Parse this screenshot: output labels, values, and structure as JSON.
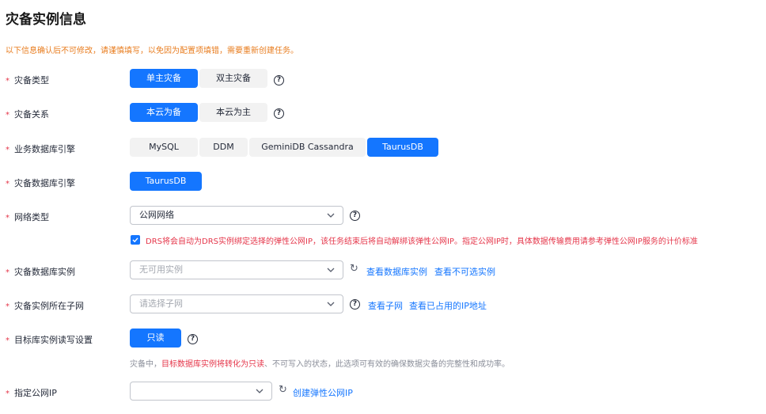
{
  "page": {
    "title": "灾备实例信息",
    "warning": "以下信息确认后不可修改，请谨慎填写，以免因为配置项填错，需要重新创建任务。"
  },
  "fields": {
    "dr_type": {
      "label": "灾备类型",
      "options": [
        "单主灾备",
        "双主灾备"
      ],
      "selected": "单主灾备"
    },
    "dr_relation": {
      "label": "灾备关系",
      "options": [
        "本云为备",
        "本云为主"
      ],
      "selected": "本云为备"
    },
    "service_engine": {
      "label": "业务数据库引擎",
      "options": [
        "MySQL",
        "DDM",
        "GeminiDB Cassandra",
        "TaurusDB"
      ],
      "selected": "TaurusDB"
    },
    "dr_engine": {
      "label": "灾备数据库引擎",
      "options": [
        "TaurusDB"
      ],
      "selected": "TaurusDB"
    },
    "network_type": {
      "label": "网络类型",
      "value": "公网网络",
      "checkbox_checked": true,
      "checkbox_text": "DRS将会自动为DRS实例绑定选择的弹性公网IP，该任务结束后将自动解绑该弹性公网IP。指定公网IP时，具体数据传输费用请参考弹性公网IP服务的计价标准"
    },
    "dr_instance": {
      "label": "灾备数据库实例",
      "placeholder": "无可用实例",
      "links": [
        "查看数据库实例",
        "查看不可选实例"
      ]
    },
    "dr_subnet": {
      "label": "灾备实例所在子网",
      "placeholder": "请选择子网",
      "links": [
        "查看子网",
        "查看已占用的IP地址"
      ]
    },
    "rw_setting": {
      "label": "目标库实例读写设置",
      "options": [
        "只读"
      ],
      "selected": "只读",
      "hint_prefix": "灾备中，",
      "hint_emphasis": "目标数据库实例将转化为只读",
      "hint_suffix": "、不可写入的状态，此选项可有效的确保数据灾备的完整性和成功率。"
    },
    "public_ip": {
      "label": "指定公网IP",
      "value": "",
      "link": "创建弹性公网IP"
    }
  },
  "colors": {
    "primary": "#1476ff",
    "required": "#e5364a",
    "warning": "#e87c1e"
  },
  "icons": [
    "help-icon",
    "chevron-down-icon",
    "refresh-icon",
    "check-icon"
  ]
}
